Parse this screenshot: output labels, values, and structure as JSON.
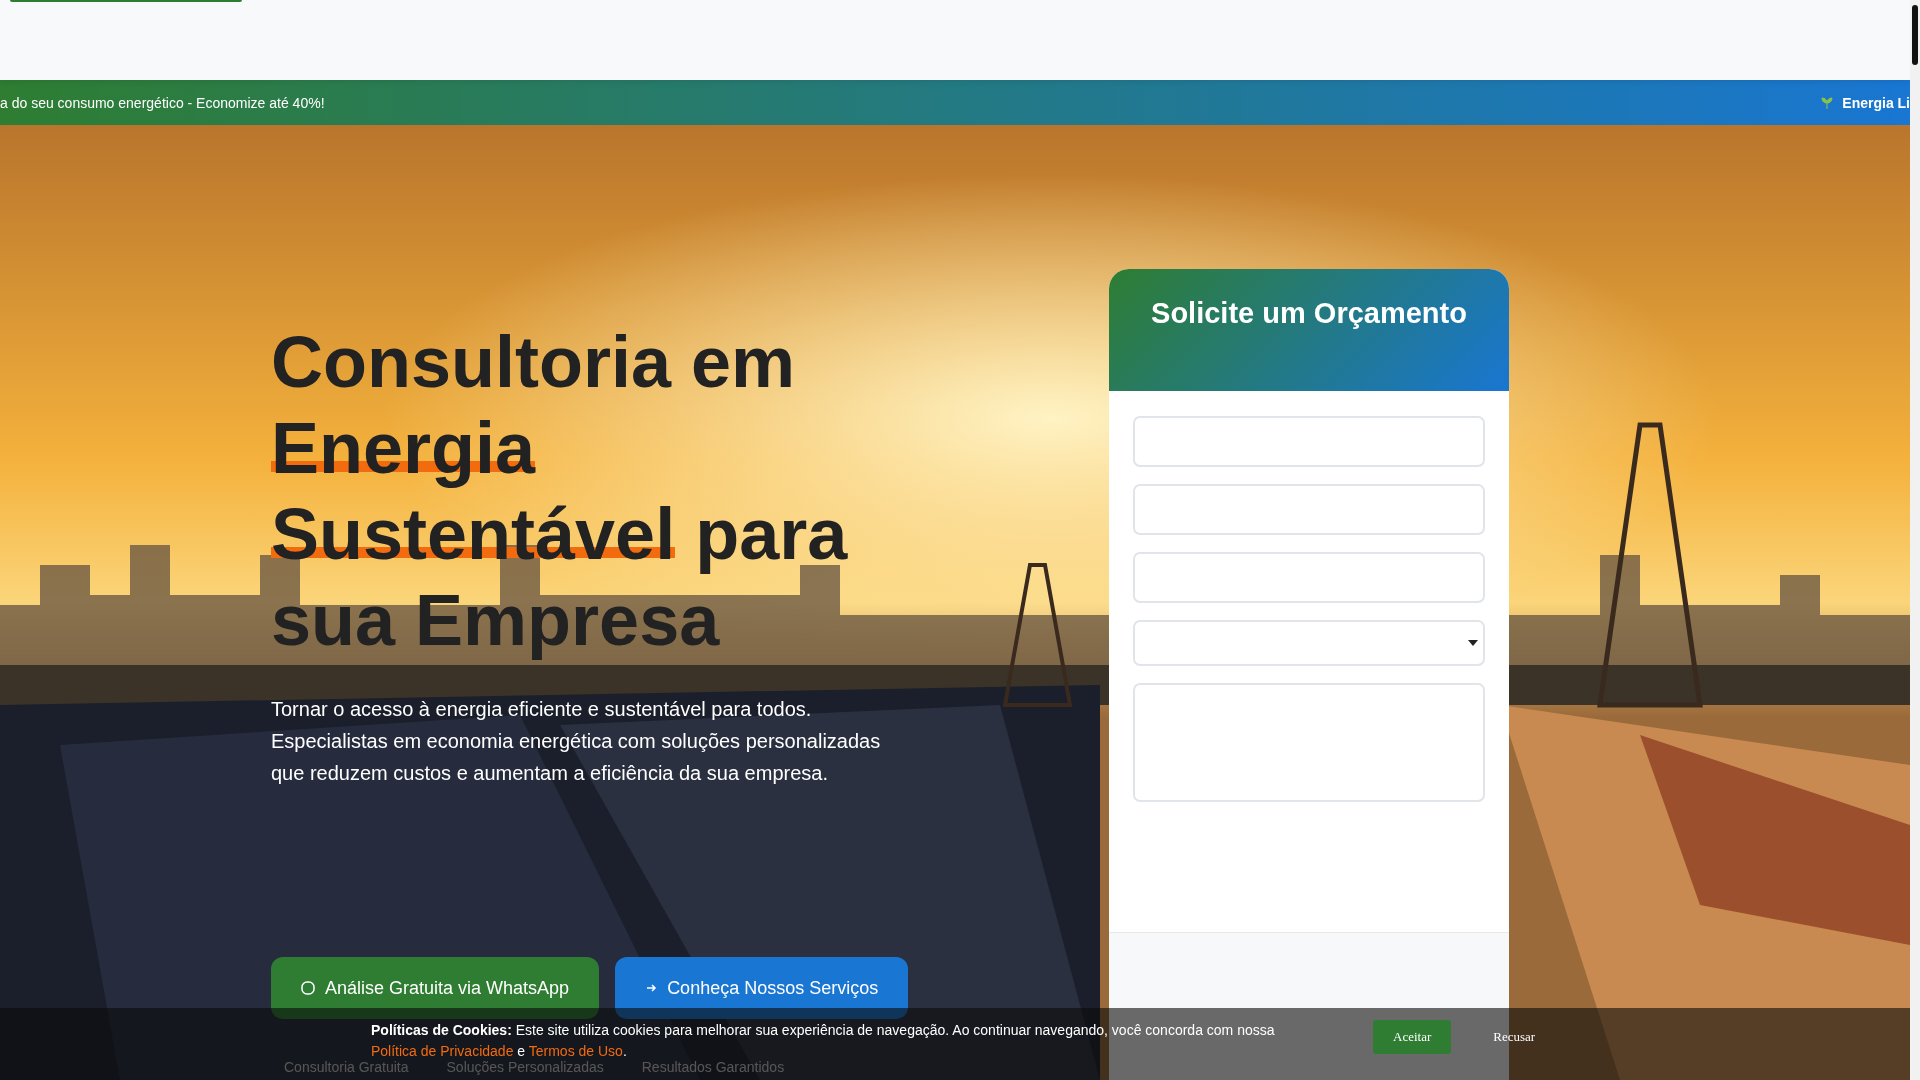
{
  "ticker": {
    "items": [
      {
        "kind": "text",
        "text": "a do seu consumo energético - Economize até 40%!"
      },
      {
        "kind": "leaf",
        "text": "Energia Li"
      }
    ]
  },
  "hero": {
    "title": [
      {
        "text": "Consultoria em ",
        "highlight": false
      },
      {
        "text": "Energia Sustentável",
        "highlight": true
      },
      {
        "text": " para sua Empresa",
        "highlight": false
      }
    ],
    "description": "Tornar o acesso à energia eficiente e sustentável para todos. Especialistas em economia energética com soluções personalizadas que reduzem custos e aumentam a eficiência da sua empresa.",
    "buttons": [
      {
        "kind": "whatsapp",
        "label": "Análise Gratuita via WhatsApp"
      },
      {
        "kind": "services",
        "label": "Conheça Nossos Serviços"
      }
    ],
    "features": [
      "Consultoria Gratuita",
      "Soluções Personalizadas",
      "Resultados Garantidos"
    ]
  },
  "form": {
    "title": "Solicite um Orçamento",
    "fields": [
      {
        "kind": "text"
      },
      {
        "kind": "text"
      },
      {
        "kind": "text"
      },
      {
        "kind": "select"
      },
      {
        "kind": "textarea"
      }
    ]
  },
  "cookie_bar": {
    "label": "Políticas de Cookies:",
    "text": "Este site utiliza cookies para melhorar sua experiência de navegação. Ao continuar navegando, você concorda com nossa",
    "links": [
      "Política de Privacidade",
      "Termos de Uso"
    ],
    "conjunction": "e",
    "end": ".",
    "buttons": [
      {
        "kind": "accept",
        "label": "Aceitar"
      },
      {
        "kind": "decline",
        "label": "Recusar"
      }
    ]
  }
}
